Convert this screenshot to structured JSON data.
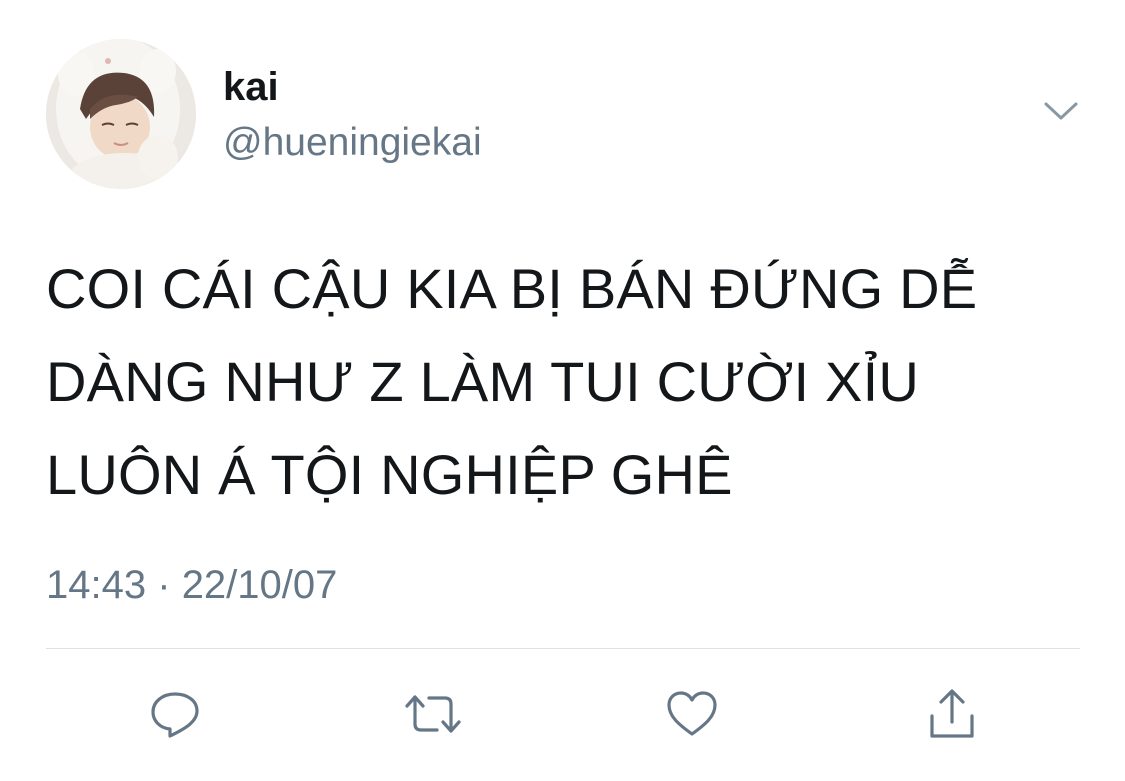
{
  "user": {
    "display_name": "kai",
    "handle": "@hueningiekai"
  },
  "tweet": {
    "lines": [
      "COI CÁI CẬU KIA BỊ BÁN ĐỨNG DỄ",
      "DÀNG NHƯ Z LÀM TUI CƯỜI XỈU",
      "LUÔN Á TỘI NGHIỆP GHÊ"
    ],
    "time": "14:43",
    "separator": "·",
    "date": "22/10/07"
  },
  "actions": [
    {
      "icon": "reply-icon"
    },
    {
      "icon": "retweet-icon"
    },
    {
      "icon": "like-icon"
    },
    {
      "icon": "share-icon"
    }
  ],
  "colors": {
    "text": "#14171a",
    "secondary": "#657786",
    "icon": "#657786",
    "divider": "#dbe2e8"
  }
}
